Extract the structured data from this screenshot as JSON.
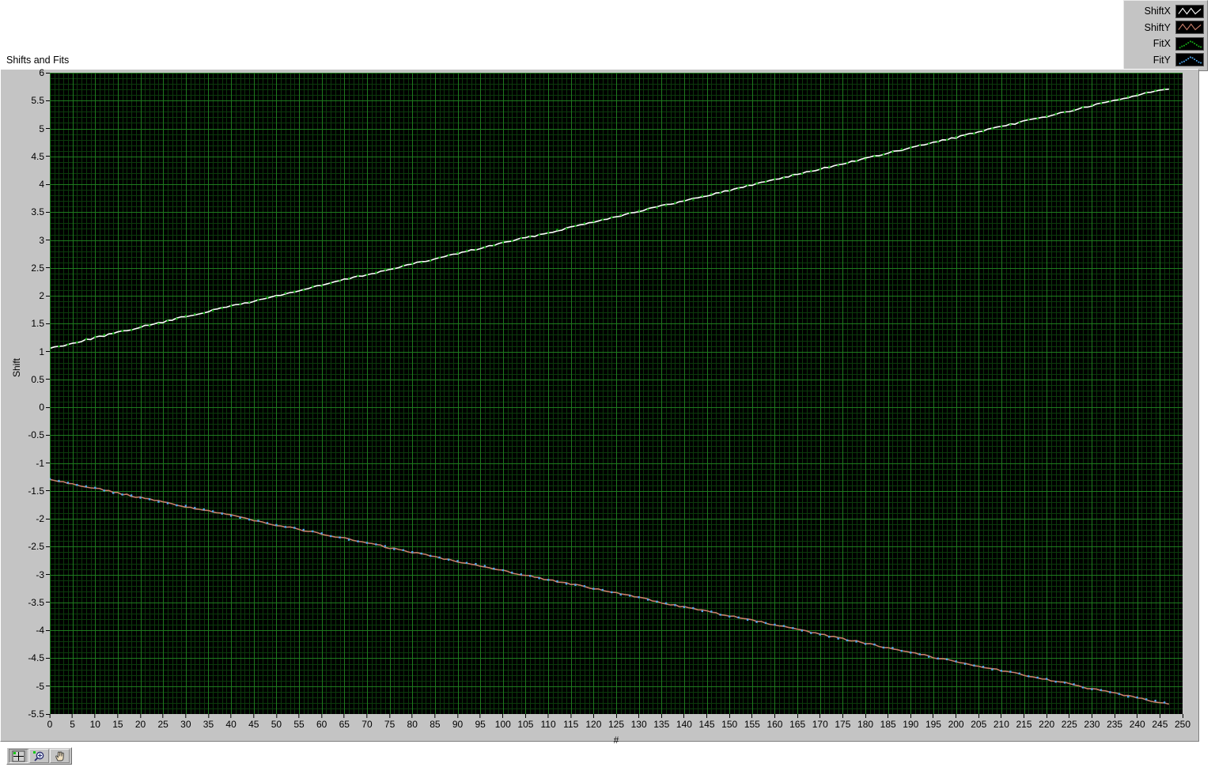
{
  "graph": {
    "title": "Shifts and Fits",
    "xlabel": "#",
    "ylabel": "Shift"
  },
  "legend": {
    "items": [
      {
        "label": "ShiftX",
        "color": "#ffffff",
        "style": "line",
        "icon": "plot-style-line-icon"
      },
      {
        "label": "ShiftY",
        "color": "#c87e6a",
        "style": "line",
        "icon": "plot-style-line-icon"
      },
      {
        "label": "FitX",
        "color": "#16b016",
        "style": "points",
        "icon": "plot-style-points-icon"
      },
      {
        "label": "FitY",
        "color": "#4ea8f0",
        "style": "points",
        "icon": "plot-style-points-icon"
      }
    ]
  },
  "palette": {
    "buttons": [
      {
        "name": "cursor-tool",
        "icon": "crosshair-icon",
        "state": "pressed"
      },
      {
        "name": "zoom-tool",
        "icon": "magnifier-icon",
        "state": "normal"
      },
      {
        "name": "pan-tool",
        "icon": "hand-icon",
        "state": "normal"
      }
    ]
  },
  "chart_data": {
    "type": "line",
    "title": "Shifts and Fits",
    "xlabel": "#",
    "ylabel": "Shift",
    "grid": true,
    "legend_position": "top-right",
    "plot_background": "#000000",
    "grid_major_color": "#1e7a1e",
    "grid_minor_color": "#0c3a0c",
    "xlim": [
      0,
      250
    ],
    "ylim": [
      -5.5,
      6
    ],
    "xticks": [
      0,
      5,
      10,
      15,
      20,
      25,
      30,
      35,
      40,
      45,
      50,
      55,
      60,
      65,
      70,
      75,
      80,
      85,
      90,
      95,
      100,
      105,
      110,
      115,
      120,
      125,
      130,
      135,
      140,
      145,
      150,
      155,
      160,
      165,
      170,
      175,
      180,
      185,
      190,
      195,
      200,
      205,
      210,
      215,
      220,
      225,
      230,
      235,
      240,
      245,
      250
    ],
    "yticks": [
      6,
      5.5,
      5,
      4.5,
      4,
      3.5,
      3,
      2.5,
      2,
      1.5,
      1,
      0.5,
      0,
      -0.5,
      -1,
      -1.5,
      -2,
      -2.5,
      -3,
      -3.5,
      -4,
      -4.5,
      -5,
      -5.5
    ],
    "x_major_step": 5,
    "y_major_step": 0.5,
    "x": [
      0,
      5,
      10,
      15,
      20,
      25,
      30,
      35,
      40,
      45,
      50,
      55,
      60,
      65,
      70,
      75,
      80,
      85,
      90,
      95,
      100,
      105,
      110,
      115,
      120,
      125,
      130,
      135,
      140,
      145,
      150,
      155,
      160,
      165,
      170,
      175,
      180,
      185,
      190,
      195,
      200,
      205,
      210,
      215,
      220,
      225,
      230,
      235,
      240,
      245,
      247
    ],
    "series": [
      {
        "name": "ShiftX",
        "color": "#ffffff",
        "style": "line",
        "values": [
          1.06,
          1.15,
          1.25,
          1.34,
          1.44,
          1.53,
          1.63,
          1.72,
          1.82,
          1.9,
          2.0,
          2.09,
          2.19,
          2.29,
          2.38,
          2.47,
          2.57,
          2.66,
          2.76,
          2.85,
          2.95,
          3.04,
          3.13,
          3.23,
          3.33,
          3.42,
          3.52,
          3.61,
          3.7,
          3.8,
          3.89,
          3.99,
          4.09,
          4.18,
          4.27,
          4.37,
          4.46,
          4.56,
          4.65,
          4.75,
          4.84,
          4.94,
          5.03,
          5.13,
          5.22,
          5.31,
          5.41,
          5.5,
          5.6,
          5.69,
          5.72
        ]
      },
      {
        "name": "ShiftY",
        "color": "#c87e6a",
        "style": "line",
        "values": [
          -1.29,
          -1.37,
          -1.45,
          -1.54,
          -1.62,
          -1.7,
          -1.78,
          -1.86,
          -1.94,
          -2.02,
          -2.11,
          -2.19,
          -2.27,
          -2.35,
          -2.43,
          -2.52,
          -2.6,
          -2.68,
          -2.76,
          -2.84,
          -2.93,
          -3.01,
          -3.09,
          -3.17,
          -3.25,
          -3.33,
          -3.41,
          -3.5,
          -3.58,
          -3.66,
          -3.74,
          -3.82,
          -3.9,
          -3.99,
          -4.07,
          -4.15,
          -4.23,
          -4.31,
          -4.39,
          -4.48,
          -4.56,
          -4.64,
          -4.72,
          -4.8,
          -4.88,
          -4.96,
          -5.05,
          -5.13,
          -5.21,
          -5.29,
          -5.32
        ]
      },
      {
        "name": "FitX",
        "color": "#16b016",
        "style": "points",
        "values": [
          1.06,
          1.15,
          1.25,
          1.34,
          1.44,
          1.53,
          1.63,
          1.72,
          1.82,
          1.9,
          2.0,
          2.09,
          2.19,
          2.29,
          2.38,
          2.47,
          2.57,
          2.66,
          2.76,
          2.85,
          2.95,
          3.04,
          3.13,
          3.23,
          3.33,
          3.42,
          3.52,
          3.61,
          3.7,
          3.8,
          3.89,
          3.99,
          4.09,
          4.18,
          4.27,
          4.37,
          4.46,
          4.56,
          4.65,
          4.75,
          4.84,
          4.94,
          5.03,
          5.13,
          5.22,
          5.31,
          5.41,
          5.5,
          5.6,
          5.69,
          5.72
        ]
      },
      {
        "name": "FitY",
        "color": "#4ea8f0",
        "style": "points",
        "values": [
          -1.29,
          -1.37,
          -1.45,
          -1.54,
          -1.62,
          -1.7,
          -1.78,
          -1.86,
          -1.94,
          -2.02,
          -2.11,
          -2.19,
          -2.27,
          -2.35,
          -2.43,
          -2.52,
          -2.6,
          -2.68,
          -2.76,
          -2.84,
          -2.93,
          -3.01,
          -3.09,
          -3.17,
          -3.25,
          -3.33,
          -3.41,
          -3.5,
          -3.58,
          -3.66,
          -3.74,
          -3.82,
          -3.9,
          -3.99,
          -4.07,
          -4.15,
          -4.23,
          -4.31,
          -4.39,
          -4.48,
          -4.56,
          -4.64,
          -4.72,
          -4.8,
          -4.88,
          -4.96,
          -5.05,
          -5.13,
          -5.21,
          -5.29,
          -5.32
        ]
      }
    ]
  }
}
